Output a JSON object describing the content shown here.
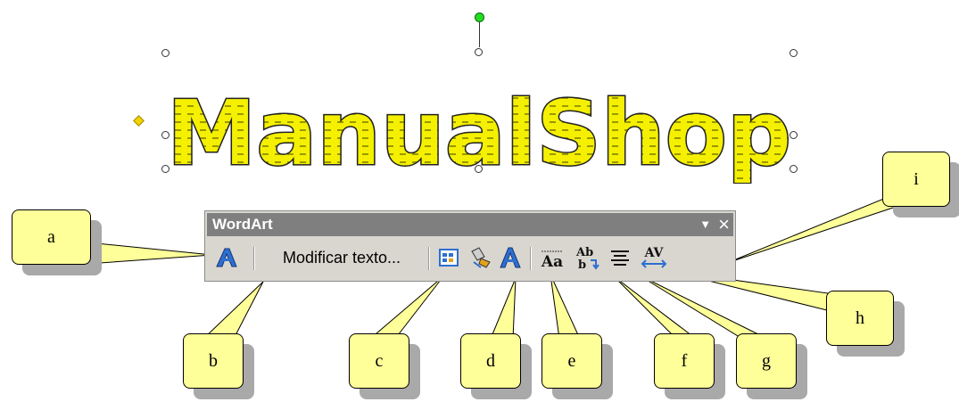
{
  "wordart_text": "ManualShop",
  "toolbar": {
    "title": "WordArt",
    "modify_text_label": "Modificar texto...",
    "buttons": [
      {
        "icon": "insert-wordart-icon"
      },
      {
        "icon": "wordart-gallery-icon"
      },
      {
        "icon": "format-wordart-icon"
      },
      {
        "icon": "wordart-shape-icon"
      },
      {
        "icon": "same-letter-heights-icon"
      },
      {
        "icon": "vertical-text-icon"
      },
      {
        "icon": "alignment-icon"
      },
      {
        "icon": "character-spacing-icon"
      }
    ],
    "icon_glyphs": {
      "same_heights": "Aa",
      "vertical": "Ab",
      "spacing": "AV"
    }
  },
  "callouts": [
    "a",
    "b",
    "c",
    "d",
    "e",
    "f",
    "g",
    "h",
    "i"
  ],
  "colors": {
    "wordart_fill": "#f5f000",
    "wordart_outline": "#222222",
    "callout_fill": "#ffff99",
    "toolbar_bg": "#d9d6cf",
    "titlebar": "#7f7f80",
    "accent_blue": "#2e6fd0",
    "rotate_handle": "#22dd22"
  }
}
